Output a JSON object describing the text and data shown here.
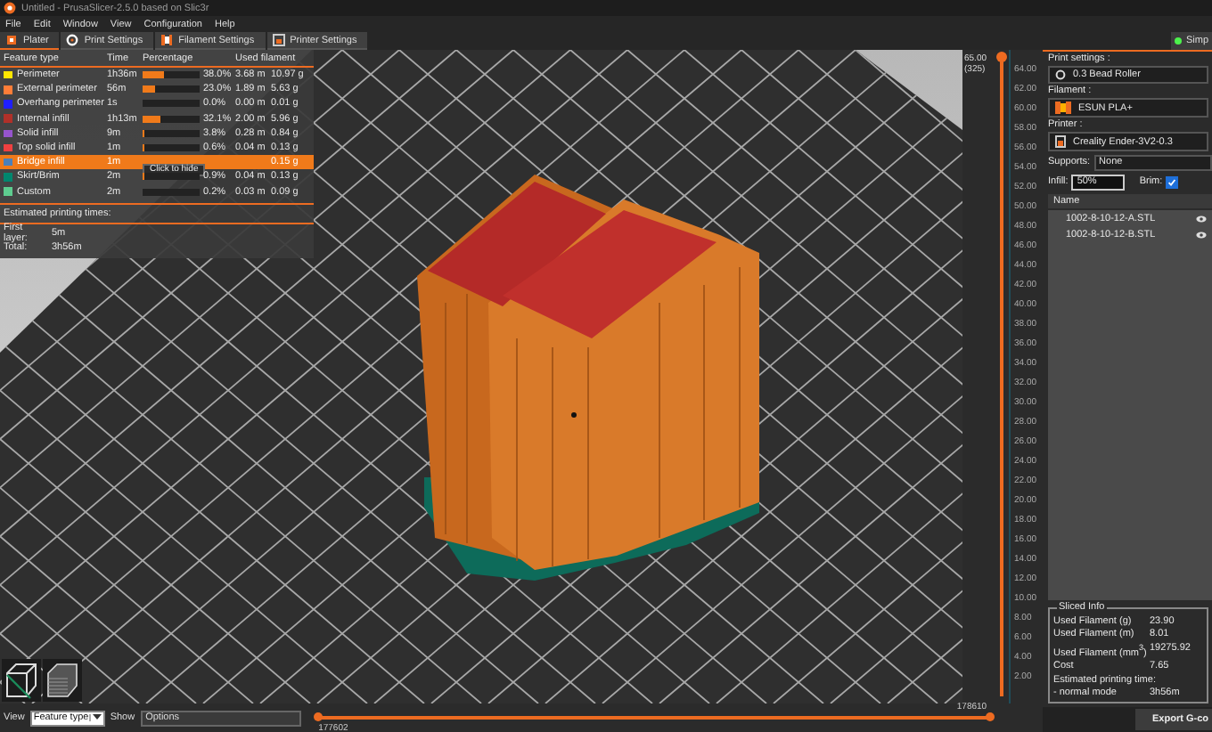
{
  "window": {
    "title": "Untitled - PrusaSlicer-2.5.0 based on Slic3r"
  },
  "menu": [
    "File",
    "Edit",
    "Window",
    "View",
    "Configuration",
    "Help"
  ],
  "tabs": [
    {
      "label": "Plater",
      "selected": true
    },
    {
      "label": "Print Settings",
      "selected": false
    },
    {
      "label": "Filament Settings",
      "selected": false
    },
    {
      "label": "Printer Settings",
      "selected": false
    }
  ],
  "mode": {
    "label": "Simp"
  },
  "legend": {
    "columns": [
      "Feature type",
      "Time",
      "Percentage",
      "Used filament"
    ],
    "rows": [
      {
        "name": "Perimeter",
        "color": "#ffe600",
        "time": "1h36m",
        "percentage": "38.0%",
        "level": 0.38,
        "length": "3.68 m",
        "weight": "10.97 g",
        "selected": false
      },
      {
        "name": "External perimeter",
        "color": "#ff7d38",
        "time": "56m",
        "percentage": "23.0%",
        "level": 0.23,
        "length": "1.89 m",
        "weight": "5.63 g",
        "selected": false
      },
      {
        "name": "Overhang perimeter",
        "color": "#1f1fff",
        "time": "1s",
        "percentage": "0.0%",
        "level": 0.0,
        "length": "0.00 m",
        "weight": "0.01 g",
        "selected": false
      },
      {
        "name": "Internal infill",
        "color": "#b03029",
        "time": "1h13m",
        "percentage": "32.1%",
        "level": 0.321,
        "length": "2.00 m",
        "weight": "5.96 g",
        "selected": false
      },
      {
        "name": "Solid infill",
        "color": "#9654cc",
        "time": "9m",
        "percentage": "3.8%",
        "level": 0.038,
        "length": "0.28 m",
        "weight": "0.84 g",
        "selected": false
      },
      {
        "name": "Top solid infill",
        "color": "#f04040",
        "time": "1m",
        "percentage": "0.6%",
        "level": 0.006,
        "length": "0.04 m",
        "weight": "0.13 g",
        "selected": false
      },
      {
        "name": "Bridge infill",
        "color": "#4d80ba",
        "time": "1m",
        "weight": "0.15 g",
        "selected": true
      },
      {
        "name": "Skirt/Brim",
        "color": "#00876e",
        "time": "2m",
        "percentage": "0.9%",
        "level": 0.009,
        "length": "0.04 m",
        "weight": "0.13 g",
        "selected": false
      },
      {
        "name": "Custom",
        "color": "#5ecc8f",
        "time": "2m",
        "percentage": "0.2%",
        "level": 0.002,
        "length": "0.03 m",
        "weight": "0.09 g",
        "selected": false
      }
    ],
    "tooltip": "Click to hide",
    "estimated_label": "Estimated printing times:",
    "first_layer": {
      "label": "First layer:",
      "value": "5m"
    },
    "total": {
      "label": "Total:",
      "value": "3h56m"
    }
  },
  "vertical_slider": {
    "top_value": "65.00",
    "top_layer": "(325)",
    "ticks": [
      "64.00",
      "62.00",
      "60.00",
      "58.00",
      "56.00",
      "54.00",
      "52.00",
      "50.00",
      "48.00",
      "46.00",
      "44.00",
      "42.00",
      "40.00",
      "38.00",
      "36.00",
      "34.00",
      "32.00",
      "30.00",
      "28.00",
      "26.00",
      "24.00",
      "22.00",
      "20.00",
      "18.00",
      "16.00",
      "14.00",
      "12.00",
      "10.00",
      "8.00",
      "6.00",
      "4.00",
      "2.00"
    ]
  },
  "bottom_bar": {
    "view_label": "View",
    "view_value": "Feature type",
    "show_label": "Show",
    "show_value": "Options"
  },
  "horizontal_slider": {
    "start": "177602",
    "end": "178610"
  },
  "sidebar": {
    "print_label": "Print settings :",
    "print_value": "0.3 Bead Roller",
    "filament_label": "Filament :",
    "filament_value": "ESUN PLA+",
    "printer_label": "Printer :",
    "printer_value": "Creality Ender-3V2-0.3",
    "supports_label": "Supports:",
    "supports_value": "None",
    "infill_label": "Infill:",
    "infill_value": "50%",
    "brim_label": "Brim:",
    "brim_checked": true,
    "list_header": "Name",
    "objects": [
      "1002-8-10-12-A.STL",
      "1002-8-10-12-B.STL"
    ]
  },
  "sliced_info": {
    "title": "Sliced Info",
    "rows": [
      {
        "label": "Used Filament (g)",
        "value": "23.90"
      },
      {
        "label": "Used Filament (m)",
        "value": "8.01"
      },
      {
        "label": "Used Filament (mm$^{3}$)",
        "value": "19275.92"
      },
      {
        "label": "Cost",
        "value": "7.65"
      }
    ],
    "time_label": "Estimated printing time:",
    "mode_label": "- normal mode",
    "time_value": "3h56m"
  },
  "export_button": "Export G-co"
}
